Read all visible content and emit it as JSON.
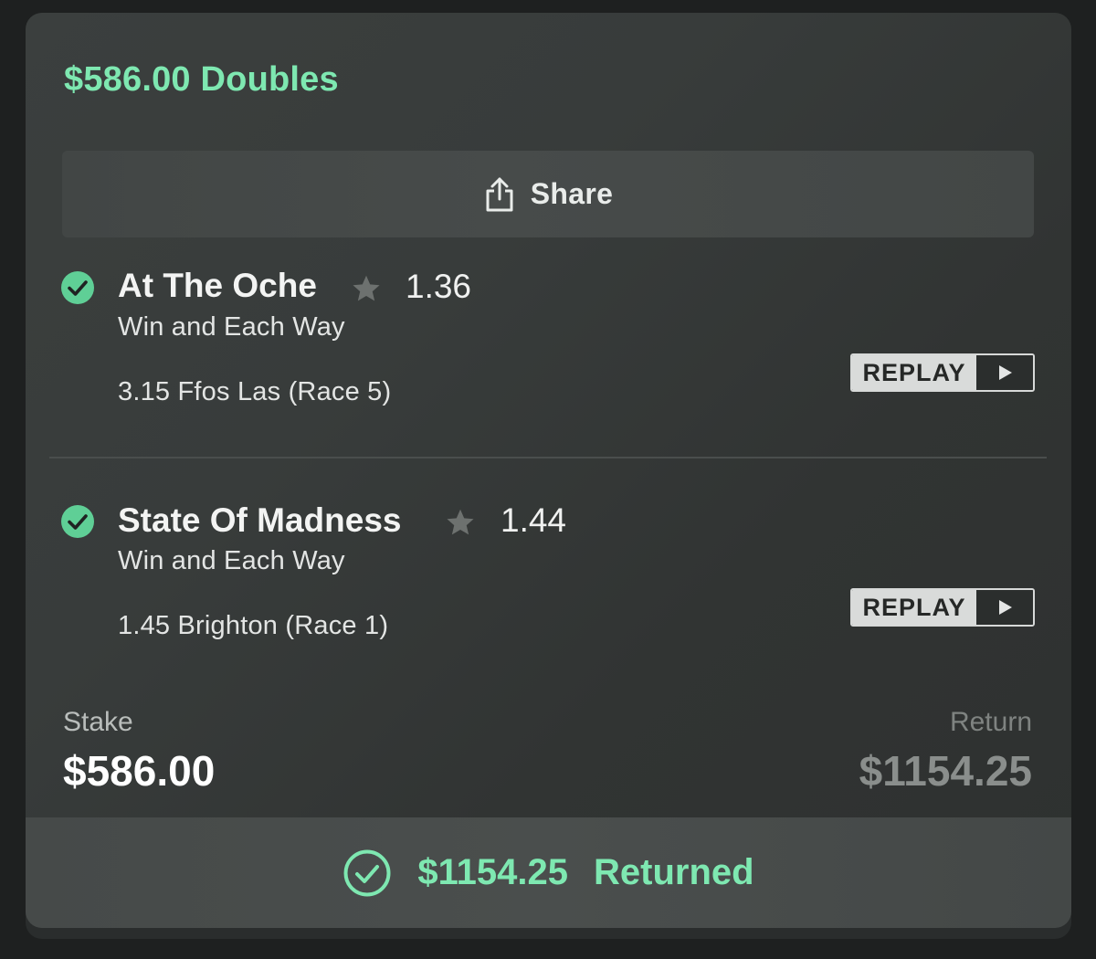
{
  "bet": {
    "title": "$586.00 Doubles",
    "accent_color": "#7ee8b1"
  },
  "share": {
    "label": "Share",
    "icon": "share-icon"
  },
  "legs": [
    {
      "status_icon": "check-circle-icon",
      "name": "At The Oche",
      "favorite_icon": "star-icon",
      "odds": "1.36",
      "market": "Win and Each Way",
      "race": "3.15 Ffos Las (Race 5)",
      "replay_label": "REPLAY"
    },
    {
      "status_icon": "check-circle-icon",
      "name": "State Of Madness",
      "favorite_icon": "star-icon",
      "odds": "1.44",
      "market": "Win and Each Way",
      "race": "1.45 Brighton (Race 1)",
      "replay_label": "REPLAY"
    }
  ],
  "summary": {
    "stake_label": "Stake",
    "stake_value": "$586.00",
    "return_label": "Return",
    "return_value": "$1154.25"
  },
  "footer": {
    "icon": "check-circle-outline-icon",
    "amount": "$1154.25",
    "label": "Returned"
  }
}
